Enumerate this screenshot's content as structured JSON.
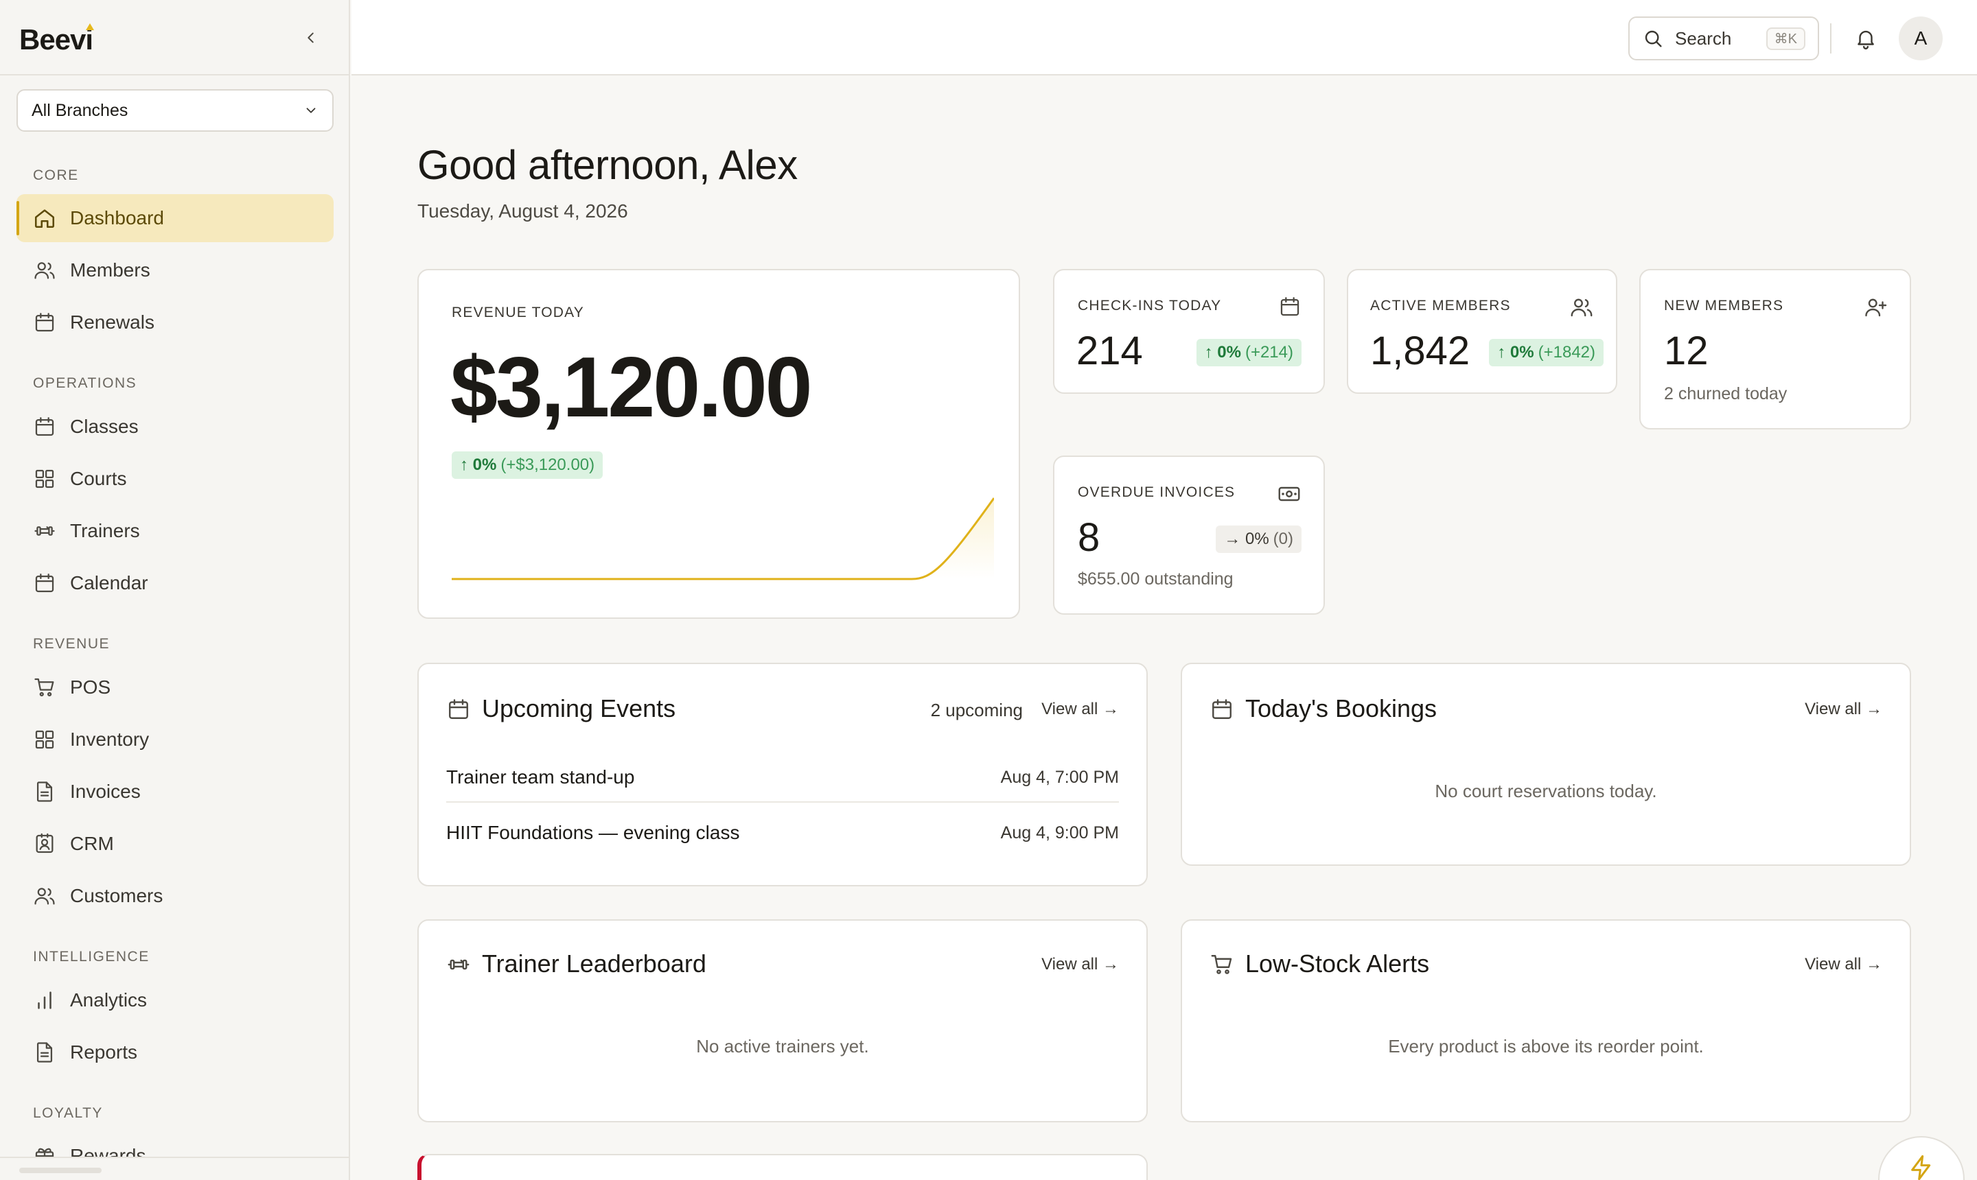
{
  "app": {
    "logo": "Beevi"
  },
  "sidebar": {
    "branch": "All Branches",
    "sections": [
      {
        "label": "CORE"
      },
      {
        "label": "OPERATIONS"
      },
      {
        "label": "REVENUE"
      },
      {
        "label": "INTELLIGENCE"
      },
      {
        "label": "LOYALTY"
      }
    ],
    "items": [
      {
        "label": "Dashboard",
        "icon": "home-icon",
        "active": true
      },
      {
        "label": "Members",
        "icon": "users-icon"
      },
      {
        "label": "Renewals",
        "icon": "calendar-icon"
      },
      {
        "label": "Classes",
        "icon": "calendar-icon"
      },
      {
        "label": "Courts",
        "icon": "grid-icon"
      },
      {
        "label": "Trainers",
        "icon": "dumbbell-icon"
      },
      {
        "label": "Calendar",
        "icon": "calendar-icon"
      },
      {
        "label": "POS",
        "icon": "cart-icon"
      },
      {
        "label": "Inventory",
        "icon": "grid-icon"
      },
      {
        "label": "Invoices",
        "icon": "document-icon"
      },
      {
        "label": "CRM",
        "icon": "contact-icon"
      },
      {
        "label": "Customers",
        "icon": "users-icon"
      },
      {
        "label": "Analytics",
        "icon": "bar-chart-icon"
      },
      {
        "label": "Reports",
        "icon": "document-icon"
      },
      {
        "label": "Rewards",
        "icon": "gift-icon"
      }
    ]
  },
  "topbar": {
    "search_label": "Search",
    "search_shortcut": "⌘K",
    "avatar_initial": "A"
  },
  "main": {
    "greeting": "Good afternoon, Alex",
    "date": "Tuesday, August 4, 2026"
  },
  "revenue": {
    "label": "REVENUE TODAY",
    "value": "$3,120.00",
    "pct": "↑ 0%",
    "delta": "(+$3,120.00)",
    "accent": "#e6b91e"
  },
  "stats": {
    "checkins": {
      "label": "CHECK-INS TODAY",
      "value": "214",
      "pct": "↑ 0%",
      "delta": "(+214)"
    },
    "active": {
      "label": "ACTIVE MEMBERS",
      "value": "1,842",
      "pct": "↑ 0%",
      "delta": "(+1842)"
    },
    "new_members": {
      "label": "NEW MEMBERS",
      "value": "12",
      "sub": "2 churned today"
    },
    "overdue": {
      "label": "OVERDUE INVOICES",
      "value": "8",
      "pct": "→ 0%",
      "delta": "(0)",
      "sub": "$655.00 outstanding"
    }
  },
  "events": {
    "title": "Upcoming Events",
    "count": "2 upcoming",
    "view_all": "View all →",
    "rows": [
      {
        "name": "Trainer team stand-up",
        "time": "Aug 4, 7:00 PM"
      },
      {
        "name": "HIIT Foundations — evening class",
        "time": "Aug 4, 9:00 PM"
      }
    ]
  },
  "bookings": {
    "title": "Today's Bookings",
    "view_all": "View all →",
    "empty": "No court reservations today."
  },
  "leaderboard": {
    "title": "Trainer Leaderboard",
    "view_all": "View all →",
    "empty": "No active trainers yet."
  },
  "lowstock": {
    "title": "Low-Stock Alerts",
    "view_all": "View all →",
    "empty": "Every product is above its reorder point."
  }
}
